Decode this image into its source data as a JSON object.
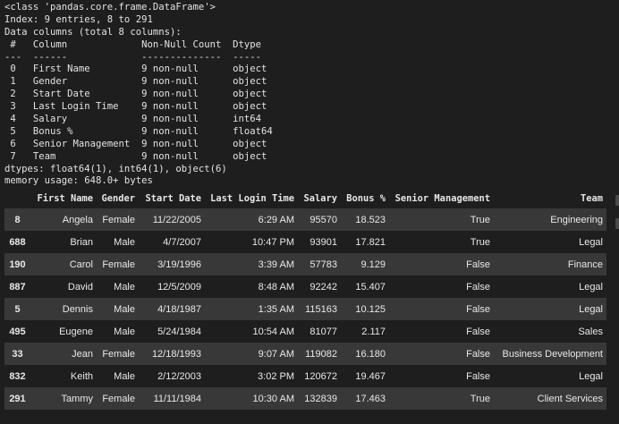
{
  "info_lines": [
    "<class 'pandas.core.frame.DataFrame'>",
    "Index: 9 entries, 8 to 291",
    "Data columns (total 8 columns):",
    " #   Column             Non-Null Count  Dtype  ",
    "---  ------             --------------  -----  ",
    " 0   First Name         9 non-null      object ",
    " 1   Gender             9 non-null      object ",
    " 2   Start Date         9 non-null      object ",
    " 3   Last Login Time    9 non-null      object ",
    " 4   Salary             9 non-null      int64  ",
    " 5   Bonus %            9 non-null      float64",
    " 6   Senior Management  9 non-null      object ",
    " 7   Team               9 non-null      object ",
    "dtypes: float64(1), int64(1), object(6)",
    "memory usage: 648.0+ bytes"
  ],
  "table": {
    "columns": [
      "",
      "First Name",
      "Gender",
      "Start Date",
      "Last Login Time",
      "Salary",
      "Bonus %",
      "Senior Management",
      "Team"
    ],
    "rows": [
      [
        "8",
        "Angela",
        "Female",
        "11/22/2005",
        "6:29 AM",
        "95570",
        "18.523",
        "True",
        "Engineering"
      ],
      [
        "688",
        "Brian",
        "Male",
        "4/7/2007",
        "10:47 PM",
        "93901",
        "17.821",
        "True",
        "Legal"
      ],
      [
        "190",
        "Carol",
        "Female",
        "3/19/1996",
        "3:39 AM",
        "57783",
        "9.129",
        "False",
        "Finance"
      ],
      [
        "887",
        "David",
        "Male",
        "12/5/2009",
        "8:48 AM",
        "92242",
        "15.407",
        "False",
        "Legal"
      ],
      [
        "5",
        "Dennis",
        "Male",
        "4/18/1987",
        "1:35 AM",
        "115163",
        "10.125",
        "False",
        "Legal"
      ],
      [
        "495",
        "Eugene",
        "Male",
        "5/24/1984",
        "10:54 AM",
        "81077",
        "2.117",
        "False",
        "Sales"
      ],
      [
        "33",
        "Jean",
        "Female",
        "12/18/1993",
        "9:07 AM",
        "119082",
        "16.180",
        "False",
        "Business Development"
      ],
      [
        "832",
        "Keith",
        "Male",
        "2/12/2003",
        "3:02 PM",
        "120672",
        "19.467",
        "False",
        "Legal"
      ],
      [
        "291",
        "Tammy",
        "Female",
        "11/11/1984",
        "10:30 AM",
        "132839",
        "17.463",
        "True",
        "Client Services"
      ]
    ]
  },
  "colors": {
    "background": "#1e1e1e",
    "row_stripe": "#383838",
    "text": "#e8e8e8"
  }
}
